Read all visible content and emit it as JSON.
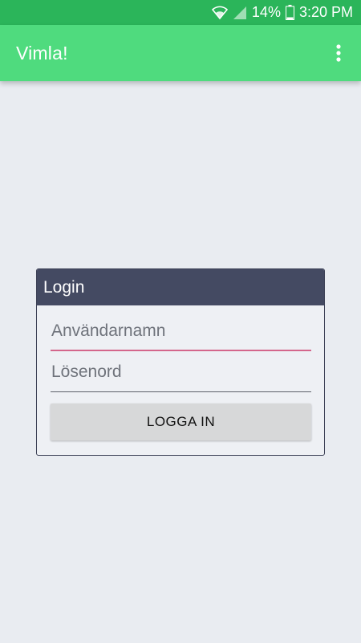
{
  "status_bar": {
    "battery_percent": "14%",
    "time": "3:20 PM",
    "icons": [
      "wifi-icon",
      "signal-icon",
      "battery-icon"
    ]
  },
  "app_bar": {
    "title": "Vimla!",
    "menu_icon": "overflow-menu-icon"
  },
  "login": {
    "header": "Login",
    "username_placeholder": "Användarnamn",
    "username_value": "",
    "password_placeholder": "Lösenord",
    "password_value": "",
    "submit_label": "LOGGA IN"
  },
  "colors": {
    "status_bar": "#2bb55a",
    "app_bar": "#4fdb7e",
    "card_header": "#444a62",
    "focused_underline": "#d4668b",
    "background": "#e9ecf1",
    "button": "#d7d8d9"
  }
}
